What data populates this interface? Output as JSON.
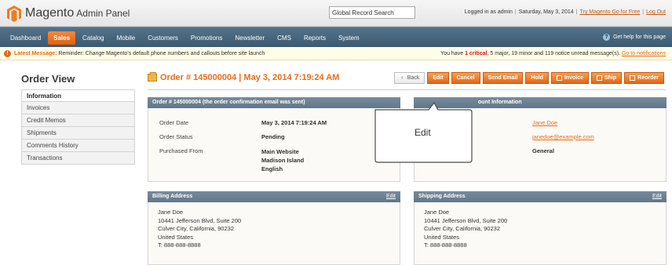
{
  "header": {
    "brand": "Magento",
    "brand_sub": "Admin Panel",
    "search_value": "Global Record Search",
    "logged_in": "Logged in as admin",
    "date": "Saturday, May 3, 2014",
    "try_link": "Try Magento Go for Free",
    "logout_link": "Log Out"
  },
  "nav": {
    "items": [
      "Dashboard",
      "Sales",
      "Catalog",
      "Mobile",
      "Customers",
      "Promotions",
      "Newsletter",
      "CMS",
      "Reports",
      "System"
    ],
    "active": "Sales",
    "help": "Get help for this page"
  },
  "notice": {
    "label": "Latest Message:",
    "text": "Reminder: Change Magento's default phone numbers and callouts before site launch",
    "right_pre": "You have",
    "critical": "1 critical",
    "right_post": ", 5 major, 19 minor and 119 notice unread message(s).",
    "link": "Go to notifications"
  },
  "sidebar": {
    "title": "Order View",
    "items": [
      "Information",
      "Invoices",
      "Credit Memos",
      "Shipments",
      "Comments History",
      "Transactions"
    ]
  },
  "page": {
    "title": "Order # 145000004 | May 3, 2014 7:19:24 AM",
    "buttons": {
      "back": "Back",
      "edit": "Edit",
      "cancel": "Cancel",
      "send_email": "Send Email",
      "hold": "Hold",
      "invoice": "Invoice",
      "ship": "Ship",
      "reorder": "Reorder"
    }
  },
  "order_panel": {
    "title": "Order # 145000004 (the order confirmation email was sent)",
    "date_label": "Order Date",
    "date_value": "May 3, 2014 7:19:24 AM",
    "status_label": "Order Status",
    "status_value": "Pending",
    "purchased_label": "Purchased From",
    "purchased_1": "Main Website",
    "purchased_2": "Madison Island",
    "purchased_3": "English"
  },
  "account_panel": {
    "title_visible": "ount Information",
    "name": "Jane Doe",
    "email": "janedoe@example.com",
    "group": "General"
  },
  "billing": {
    "title": "Billing Address",
    "edit": "Edit",
    "lines": [
      "Jane Doe",
      "10441 Jefferson Blvd, Suite 200",
      "Culver City, California, 90232",
      "United States",
      "T: 888-888-8888"
    ]
  },
  "shipping": {
    "title": "Shipping Address",
    "edit": "Edit",
    "lines": [
      "Jane Doe",
      "10441 Jefferson Blvd, Suite 200",
      "Culver City, California, 90232",
      "United States",
      "T: 888-888-8888"
    ]
  },
  "callout": {
    "text": "Edit"
  },
  "colors": {
    "accent": "#eb6b16",
    "nav": "#46647a",
    "panel_head": "#6b8091"
  }
}
